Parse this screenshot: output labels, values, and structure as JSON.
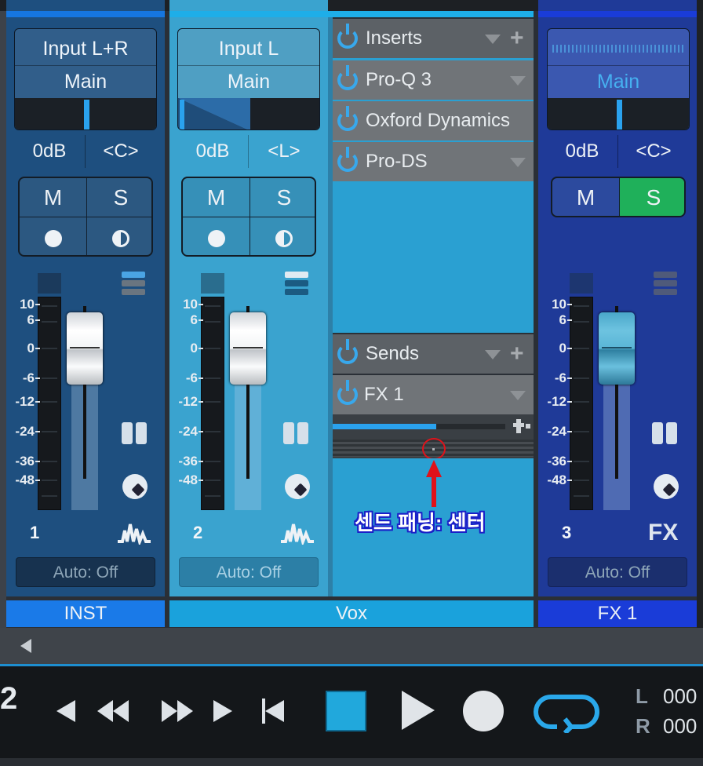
{
  "strips": [
    {
      "io_line1": "Input L+R",
      "io_line2": "Main",
      "volume": "0dB",
      "pan": "<C>",
      "mute": "M",
      "solo": "S",
      "number": "1",
      "type_icon": "waveform-icon",
      "automation": "Auto: Off",
      "name": "INST"
    },
    {
      "io_line1": "Input L",
      "io_line2": "Main",
      "volume": "0dB",
      "pan": "<L>",
      "mute": "M",
      "solo": "S",
      "number": "2",
      "type_icon": "waveform-icon",
      "automation": "Auto: Off",
      "name": "Vox"
    },
    {
      "io_line1": "",
      "io_line2": "Main",
      "volume": "0dB",
      "pan": "<C>",
      "mute": "M",
      "solo": "S",
      "number": "3",
      "type_label": "FX",
      "automation": "Auto: Off",
      "name": "FX 1"
    }
  ],
  "scale_marks": [
    "10",
    "6",
    "0",
    "-6",
    "-12",
    "-24",
    "-36",
    "-48"
  ],
  "inserts": {
    "header": "Inserts",
    "items": [
      "Pro-Q 3",
      "Oxford Dynamics",
      "Pro-DS"
    ]
  },
  "sends": {
    "header": "Sends",
    "items": [
      "FX 1"
    ],
    "level_fraction": 0.6
  },
  "annotation": "센드 패닝: 센터",
  "transport": {
    "left_digit": "2",
    "l_label": "L",
    "r_label": "R",
    "l_value": "000",
    "r_value": "000"
  },
  "colors": {
    "inst": "#1e4f7f",
    "vox": "#3aa3cf",
    "fx": "#1f3a98",
    "solo_active": "#1fb05a",
    "accent": "#38a8ec"
  }
}
